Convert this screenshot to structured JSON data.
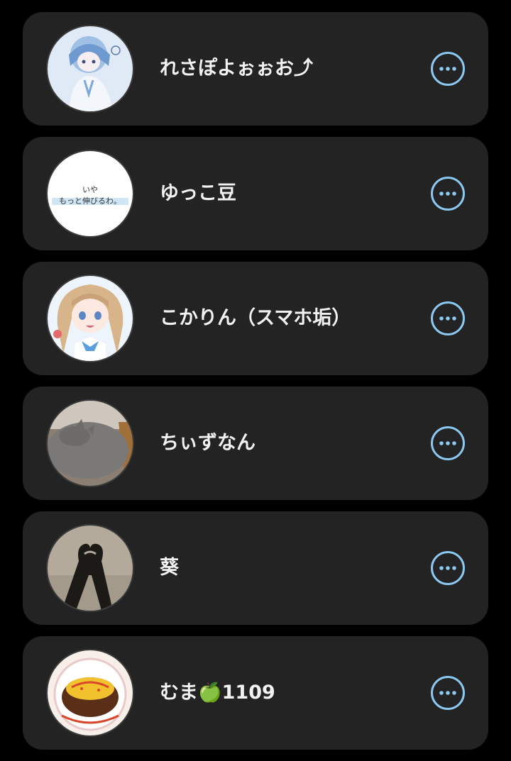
{
  "accent_color": "#8cc8f0",
  "friends": [
    {
      "name": "れさぽよぉぉお⤴",
      "avatar_icon": "anime-girl-blue-avatar"
    },
    {
      "name": "ゆっこ豆",
      "avatar_icon": "handwritten-text-avatar",
      "avatar_text_top": "いや",
      "avatar_text_bottom": "もっと伸びるわ。"
    },
    {
      "name": "こかりん（スマホ垢）",
      "avatar_icon": "anime-girl-blonde-avatar"
    },
    {
      "name": "ちぃずなん",
      "avatar_icon": "gray-cat-avatar"
    },
    {
      "name": "葵",
      "avatar_icon": "heart-shadow-avatar"
    },
    {
      "name": "むま🍏1109",
      "avatar_icon": "omurice-avatar"
    }
  ],
  "more_button_icon": "ellipsis-circle-icon"
}
